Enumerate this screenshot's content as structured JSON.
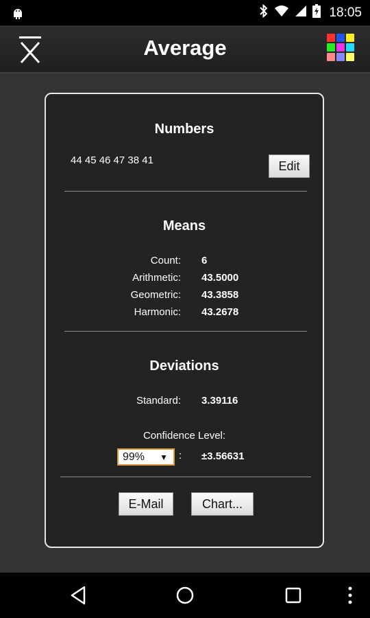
{
  "status_bar": {
    "time": "18:05",
    "icons": [
      "android-icon",
      "bluetooth-icon",
      "wifi-icon",
      "cell-signal-icon",
      "battery-icon"
    ]
  },
  "app_bar": {
    "title": "Average",
    "app_icon": "x-bar-icon",
    "menu_icon": "color-grid-icon",
    "grid_colors": [
      "#ff3030",
      "#2255ee",
      "#ffee22",
      "#22ee22",
      "#ee33ee",
      "#22ddff",
      "#ff8888",
      "#8888ff",
      "#ffff66"
    ]
  },
  "numbers": {
    "title": "Numbers",
    "values_text": "44 45 46 47 38 41",
    "edit_label": "Edit"
  },
  "means": {
    "title": "Means",
    "rows": [
      {
        "label": "Count:",
        "value": "6"
      },
      {
        "label": "Arithmetic:",
        "value": "43.5000"
      },
      {
        "label": "Geometric:",
        "value": "43.3858"
      },
      {
        "label": "Harmonic:",
        "value": "43.2678"
      }
    ]
  },
  "deviations": {
    "title": "Deviations",
    "standard_label": "Standard:",
    "standard_value": "3.39116",
    "confidence_label": "Confidence Level:",
    "confidence_selected": "99%",
    "confidence_colon": ":",
    "confidence_value": "±3.56631"
  },
  "actions": {
    "email_label": "E-Mail",
    "chart_label": "Chart..."
  },
  "nav_bar": {
    "icons": [
      "back-icon",
      "home-icon",
      "recents-icon",
      "overflow-menu-icon"
    ]
  }
}
